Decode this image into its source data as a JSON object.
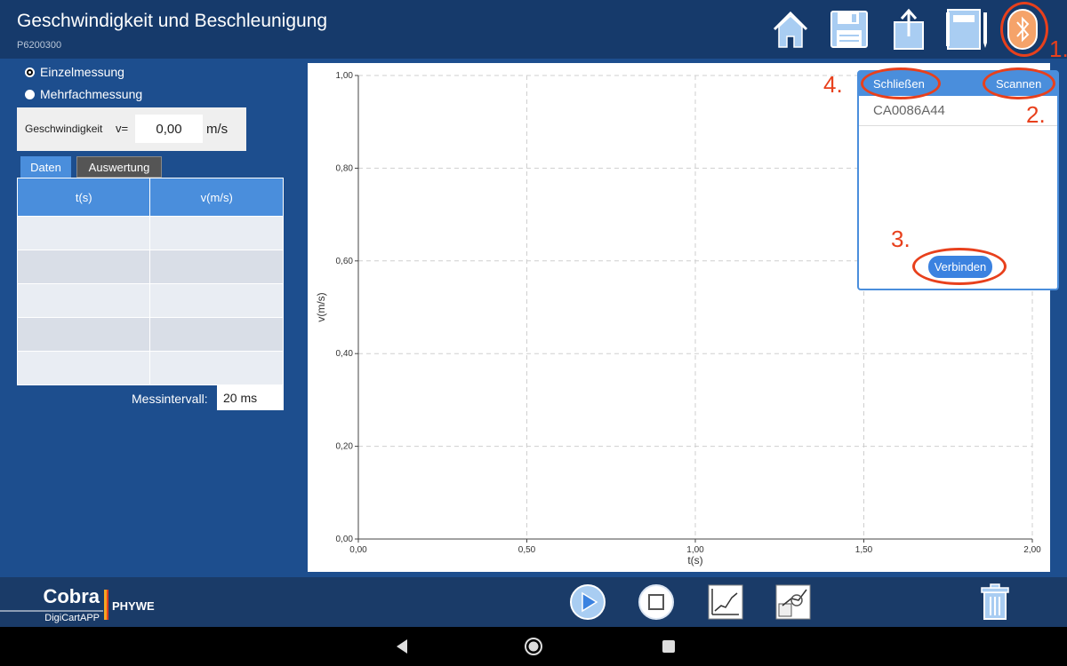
{
  "header": {
    "title": "Geschwindigkeit und Beschleunigung",
    "subtitle": "P6200300",
    "buttons": [
      "home-icon",
      "save-icon",
      "share-icon",
      "notebook-icon",
      "bluetooth-icon"
    ]
  },
  "measurement_mode": {
    "options": [
      {
        "label": "Einzelmessung",
        "selected": true
      },
      {
        "label": "Mehrfachmessung",
        "selected": false
      }
    ]
  },
  "speed": {
    "label": "Geschwindigkeit",
    "symbol": "v=",
    "value": "0,00",
    "unit": "m/s"
  },
  "tabs": [
    {
      "label": "Daten",
      "active": true
    },
    {
      "label": "Auswertung",
      "active": false
    }
  ],
  "table": {
    "headers": [
      "t(s)",
      "v(m/s)"
    ],
    "rows": [
      [
        "",
        ""
      ],
      [
        "",
        ""
      ],
      [
        "",
        ""
      ],
      [
        "",
        ""
      ],
      [
        "",
        ""
      ]
    ]
  },
  "interval": {
    "label": "Messintervall:",
    "value": "20 ms"
  },
  "chart_data": {
    "type": "line",
    "series": [],
    "xlabel": "t(s)",
    "ylabel": "v(m/s)",
    "xlim": [
      0,
      2
    ],
    "ylim": [
      0,
      1
    ],
    "xticks": [
      "0,00",
      "0,50",
      "1,00",
      "1,50",
      "2,00"
    ],
    "yticks": [
      "0,00",
      "0,20",
      "0,40",
      "0,60",
      "0,80",
      "1,00"
    ],
    "grid": true
  },
  "bluetooth_popup": {
    "close_label": "Schließen",
    "scan_label": "Scannen",
    "devices": [
      "CA0086A44"
    ],
    "connect_label": "Verbinden"
  },
  "annotations": {
    "n1": "1.",
    "n2": "2.",
    "n3": "3.",
    "n4": "4.",
    "color": "#e8401c"
  },
  "footer": {
    "logo_main": "Cobra",
    "logo_sub": "DigiCartAPP",
    "brand": "PHYWE",
    "buttons": [
      "play-icon",
      "stop-icon",
      "chart-icon",
      "evaluation-icon",
      "trash-icon"
    ]
  },
  "colors": {
    "background": "#1d4e8e",
    "header": "#163a6b",
    "accent": "#4a8edc",
    "annotation": "#e8401c"
  }
}
